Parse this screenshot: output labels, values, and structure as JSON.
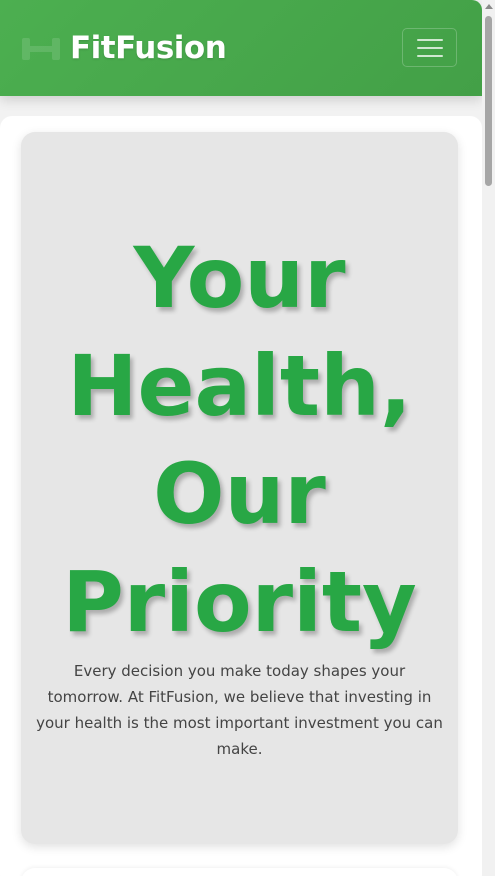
{
  "header": {
    "brand_name": "FitFusion",
    "brand_icon": "dumbbell-icon",
    "menu_icon": "hamburger-menu-icon",
    "background_color": "#4caf50"
  },
  "hero": {
    "title": "Your Health, Our Priority",
    "text": "Every decision you make today shapes your tomorrow. At FitFusion, we believe that investing in your health is the most important investment you can make.",
    "title_color": "#28a745",
    "card_color": "#e6e6e6"
  }
}
